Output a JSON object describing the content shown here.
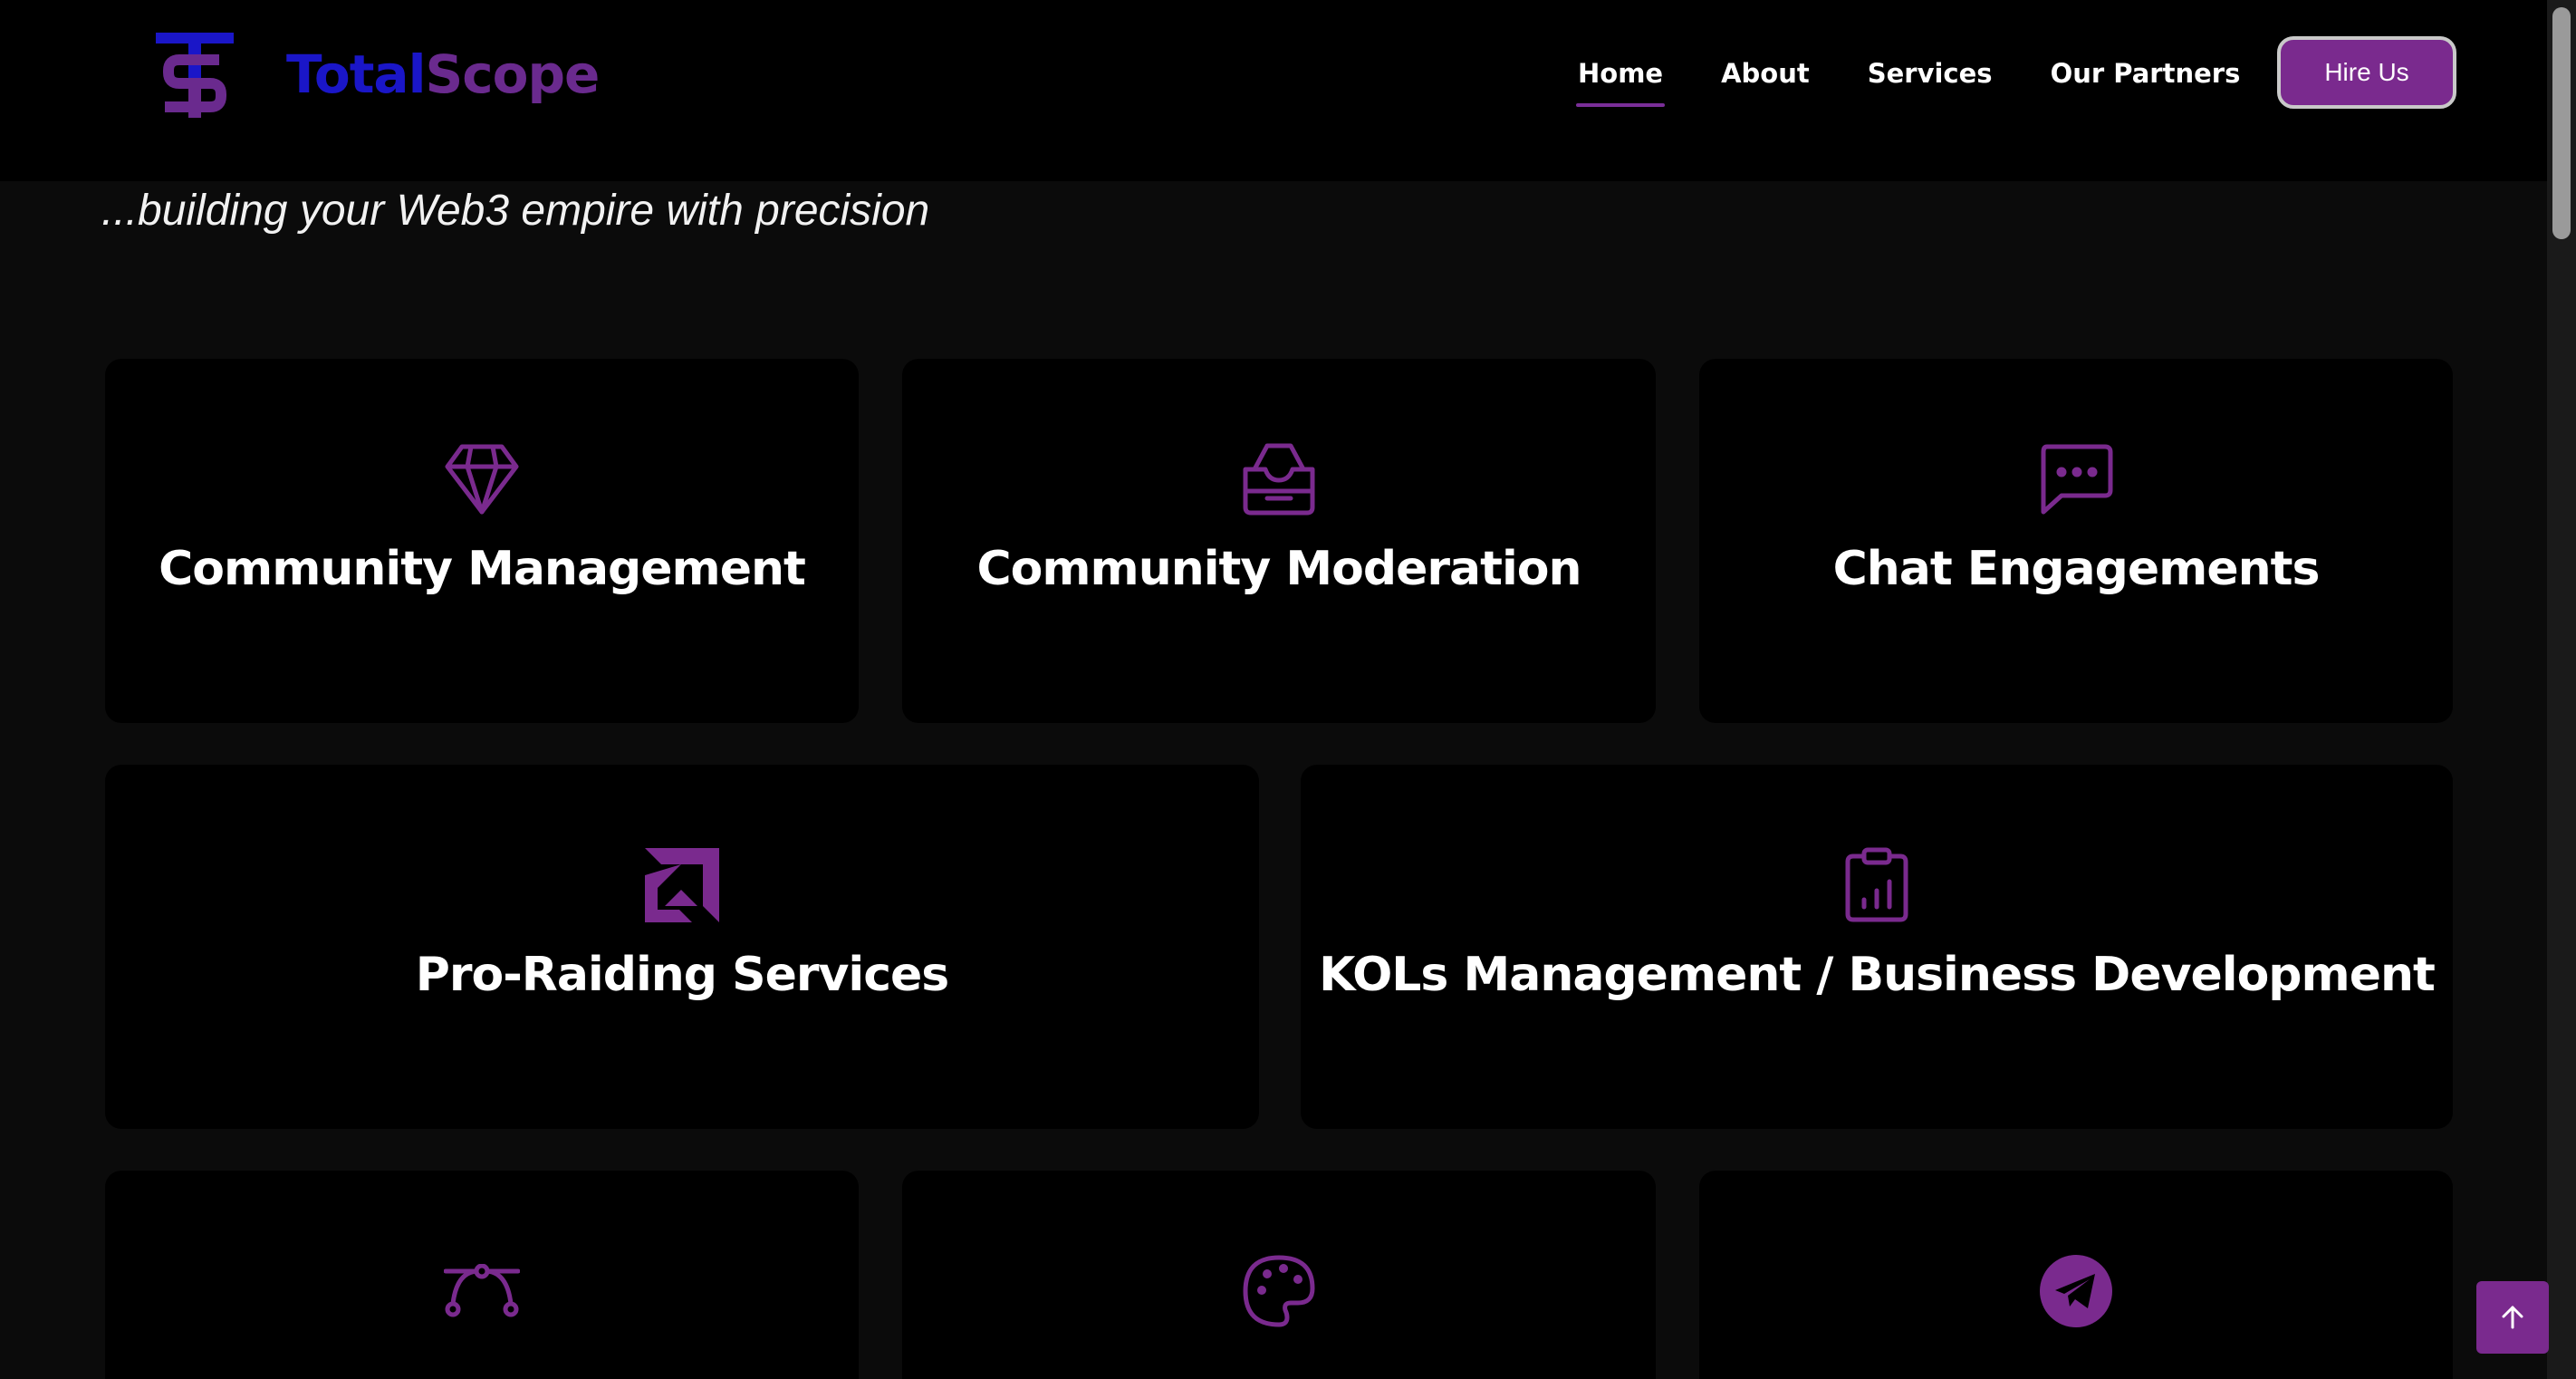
{
  "header": {
    "logo_text_part1": "Total",
    "logo_text_part2": "Scope",
    "nav": [
      {
        "label": "Home",
        "active": true
      },
      {
        "label": "About",
        "active": false
      },
      {
        "label": "Services",
        "active": false
      },
      {
        "label": "Our Partners",
        "active": false
      }
    ],
    "hire_label": "Hire Us"
  },
  "tagline": "...building your Web3 empire with precision",
  "services": [
    {
      "title": "Community Management",
      "icon": "diamond-icon"
    },
    {
      "title": "Community Moderation",
      "icon": "inbox-stack-icon"
    },
    {
      "title": "Chat Engagements",
      "icon": "chat-dots-icon"
    },
    {
      "title": "Pro-Raiding Services",
      "icon": "amd-arrow-icon"
    },
    {
      "title": "KOLs Management / Business Development",
      "icon": "clipboard-chart-icon"
    },
    {
      "title": "",
      "icon": "bezier-curve-icon"
    },
    {
      "title": "",
      "icon": "palette-icon"
    },
    {
      "title": "",
      "icon": "telegram-icon"
    }
  ],
  "colors": {
    "accent": "#7a2a8e",
    "logo_blue": "#1a16c8",
    "logo_purple": "#6a2a8e",
    "background": "#0b0b0b",
    "card": "#000000"
  },
  "scroll_top_icon": "arrow-up-icon"
}
